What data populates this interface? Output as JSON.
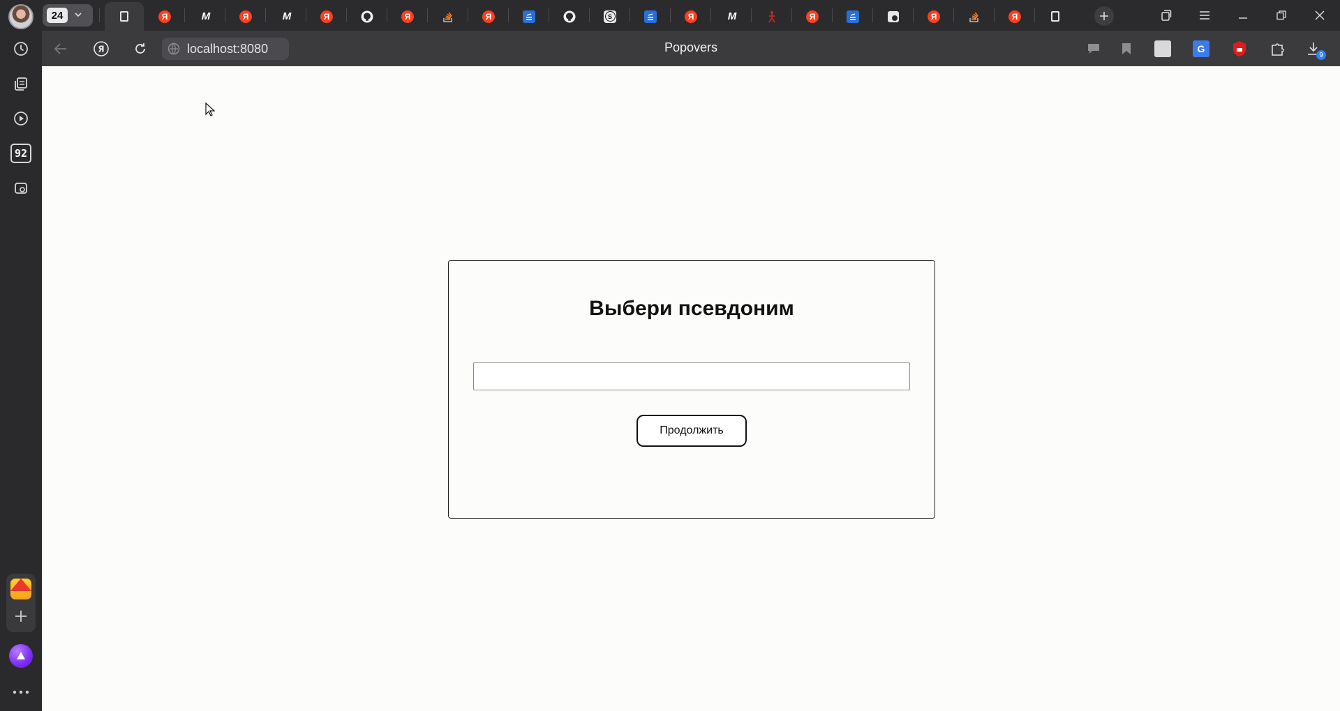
{
  "sidebar": {
    "tab_counter_badge": "92",
    "items": [
      {
        "name": "history-icon"
      },
      {
        "name": "collections-icon"
      },
      {
        "name": "video-icon"
      },
      {
        "name": "counter-badge"
      },
      {
        "name": "screenshot-icon"
      }
    ]
  },
  "tabstrip": {
    "tab_count": "24",
    "tabs": [
      {
        "favicon": "document-icon",
        "active": true
      },
      {
        "favicon": "yandex-icon",
        "letter": "Я"
      },
      {
        "favicon": "m-logo-icon",
        "letter": "M"
      },
      {
        "favicon": "yandex-icon",
        "letter": "Я"
      },
      {
        "favicon": "m-logo-icon",
        "letter": "M"
      },
      {
        "favicon": "yandex-icon",
        "letter": "Я"
      },
      {
        "favicon": "github-icon"
      },
      {
        "favicon": "yandex-icon",
        "letter": "Я"
      },
      {
        "favicon": "stackoverflow-icon"
      },
      {
        "favicon": "yandex-icon",
        "letter": "Я"
      },
      {
        "favicon": "blue-app-icon"
      },
      {
        "favicon": "github-icon"
      },
      {
        "favicon": "s-logo-icon",
        "letter": "S"
      },
      {
        "favicon": "blue-app-icon"
      },
      {
        "favicon": "yandex-icon",
        "letter": "Я"
      },
      {
        "favicon": "m-logo-icon",
        "letter": "M"
      },
      {
        "favicon": "red-figure-icon"
      },
      {
        "favicon": "yandex-icon",
        "letter": "Я"
      },
      {
        "favicon": "blue-app-icon"
      },
      {
        "favicon": "puzzle-icon"
      },
      {
        "favicon": "yandex-icon",
        "letter": "Я"
      },
      {
        "favicon": "stackoverflow-icon"
      },
      {
        "favicon": "yandex-icon",
        "letter": "Я"
      },
      {
        "favicon": "document-icon"
      }
    ]
  },
  "addressbar": {
    "url": "localhost:8080",
    "page_title": "Popovers",
    "downloads_badge": "9"
  },
  "page": {
    "title": "Выбери псевдоним",
    "input_value": "",
    "input_placeholder": "",
    "button_label": "Продолжить"
  },
  "colors": {
    "chrome_dark": "#2b2b2d",
    "toolbar": "#3b3b3e",
    "page_bg": "#fcfcfa",
    "yandex_red": "#fc3f1d",
    "alice_purple": "#7b2cf2"
  }
}
